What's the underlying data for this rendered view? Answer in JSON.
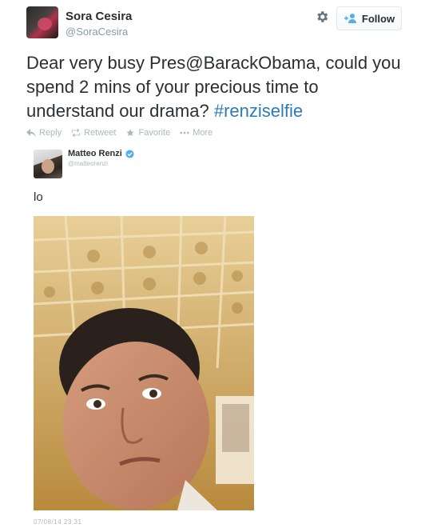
{
  "user": {
    "fullname": "Sora Cesira",
    "screenname": "@SoraCesira"
  },
  "header": {
    "follow_label": "Follow"
  },
  "tweet": {
    "text_before": "Dear very busy Pres@BarackObama, could you spend 2 mins of your precious time to understand our drama? ",
    "hashtag": "#renziselfie"
  },
  "actions": {
    "reply": "Reply",
    "retweet": "Retweet",
    "favorite": "Favorite",
    "more": "More"
  },
  "embedded": {
    "fullname": "Matteo Renzi",
    "screenname": "@matteorenzi",
    "text": "lo",
    "timestamp": "07/08/14 23:31"
  },
  "colors": {
    "hashtag": "#2b7bb9",
    "muted": "#8899a6",
    "verified": "#55acee",
    "follow_icon": "#55acee"
  },
  "icons": [
    "gear-icon",
    "follow-person-icon",
    "reply-icon",
    "retweet-icon",
    "favorite-star-icon",
    "more-dots-icon",
    "verified-badge-icon"
  ]
}
